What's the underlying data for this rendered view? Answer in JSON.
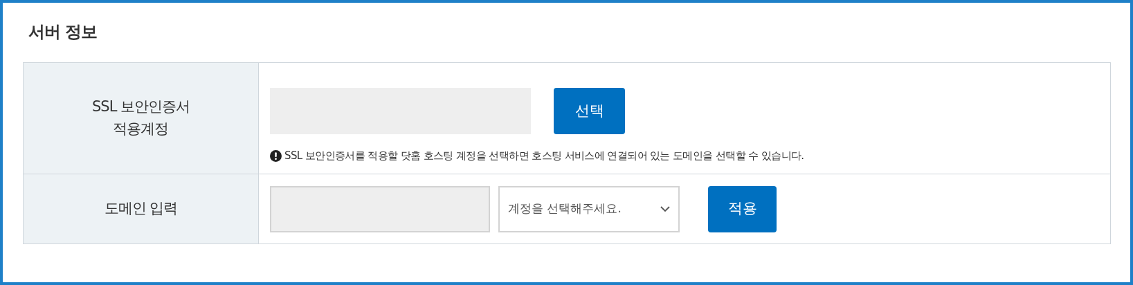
{
  "title": "서버 정보",
  "rows": [
    {
      "kind": "certificate",
      "label": "SSL 보안인증서\n적용계정",
      "button": "선택",
      "note": "SSL 보안인증서를 적용할 닷홈 호스팅 계정을 선택하면 호스팅 서비스에 연결되어 있는 도메인을 선택할 수 있습니다."
    },
    {
      "kind": "domain",
      "label": "도메인 입력",
      "select": "계정을 선택해주세요.",
      "button": "적용"
    }
  ]
}
